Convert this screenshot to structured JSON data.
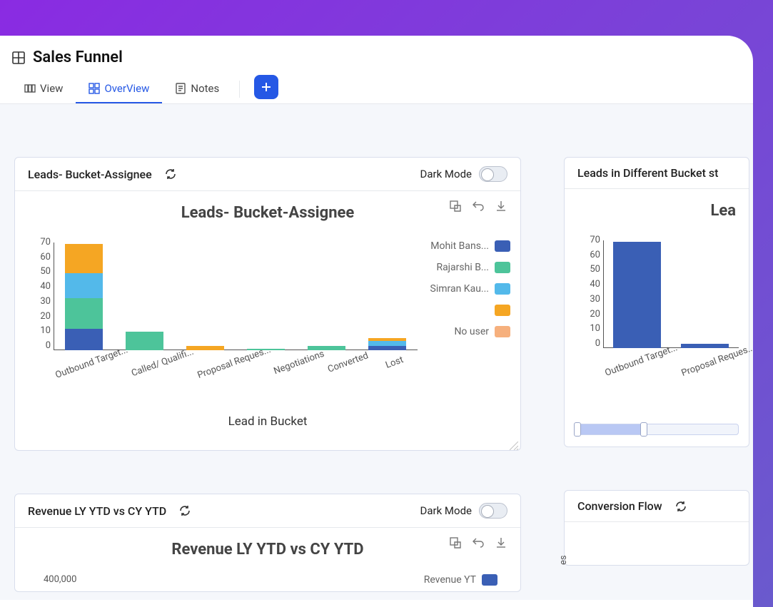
{
  "page": {
    "title": "Sales Funnel"
  },
  "tabs": {
    "view": "View",
    "overview": "OverView",
    "notes": "Notes"
  },
  "colors": {
    "mohit": "#3a5fb5",
    "rajarshi": "#4dc49a",
    "simran": "#53b9ea",
    "orange": "#f5a623",
    "nouser": "#f6b07d"
  },
  "card1": {
    "header_title": "Leads- Bucket-Assignee",
    "dark_label": "Dark Mode",
    "chart_title": "Leads- Bucket-Assignee",
    "x_axis_title": "Lead in Bucket"
  },
  "card2": {
    "header_title": "Leads in Different Bucket st",
    "chart_title_partial": "Lea"
  },
  "card3": {
    "header_title": "Revenue LY YTD vs CY YTD",
    "dark_label": "Dark Mode",
    "chart_title": "Revenue LY YTD vs CY YTD",
    "y_tick_top": "400,000"
  },
  "card4": {
    "header_title": "Conversion Flow"
  },
  "chart_data": [
    {
      "id": "leads_bucket_assignee",
      "type": "bar",
      "stacked": true,
      "title": "Leads- Bucket-Assignee",
      "xlabel": "Lead in Bucket",
      "ylabel": "",
      "ylim": [
        0,
        70
      ],
      "y_ticks": [
        0,
        10,
        20,
        30,
        40,
        50,
        60,
        70
      ],
      "categories": [
        "Outbound Target...",
        "Called/ Qualifi...",
        "Proposal Reques...",
        "Negotiations",
        "Converted",
        "Lost"
      ],
      "series": [
        {
          "name": "Mohit Bans...",
          "color": "#3a5fb5",
          "values": [
            14,
            0,
            0,
            0,
            0,
            3
          ]
        },
        {
          "name": "Rajarshi B...",
          "color": "#4dc49a",
          "values": [
            20,
            12,
            0,
            1,
            3,
            0
          ]
        },
        {
          "name": "Simran Kau...",
          "color": "#53b9ea",
          "values": [
            16,
            0,
            0,
            0,
            0,
            3
          ]
        },
        {
          "name": "",
          "color": "#f5a623",
          "values": [
            19,
            0,
            3,
            0,
            0,
            2
          ]
        },
        {
          "name": "No user",
          "color": "#f6b07d",
          "values": [
            0,
            0,
            0,
            0,
            0,
            0
          ]
        }
      ]
    },
    {
      "id": "leads_different_bucket",
      "type": "bar",
      "stacked": false,
      "title": "Lea",
      "ylim": [
        0,
        70
      ],
      "y_ticks": [
        0,
        10,
        20,
        30,
        40,
        50,
        60,
        70
      ],
      "categories": [
        "Outbound Target...",
        "Proposal Reques..."
      ],
      "series": [
        {
          "name": "",
          "color": "#3a5fb5",
          "values": [
            69,
            3
          ]
        }
      ]
    },
    {
      "id": "revenue_ly_cy_ytd",
      "type": "bar",
      "title": "Revenue LY YTD vs CY YTD",
      "ylim": [
        0,
        400000
      ],
      "y_ticks": [
        400000
      ],
      "series": [
        {
          "name": "Revenue YT",
          "color": "#3a5fb5",
          "values": []
        }
      ],
      "categories": []
    }
  ],
  "legend1": {
    "mohit": "Mohit Bans...",
    "rajarshi": "Rajarshi B...",
    "simran": "Simran Kau...",
    "nouser": "No user"
  },
  "legend3": {
    "rev": "Revenue YT"
  }
}
